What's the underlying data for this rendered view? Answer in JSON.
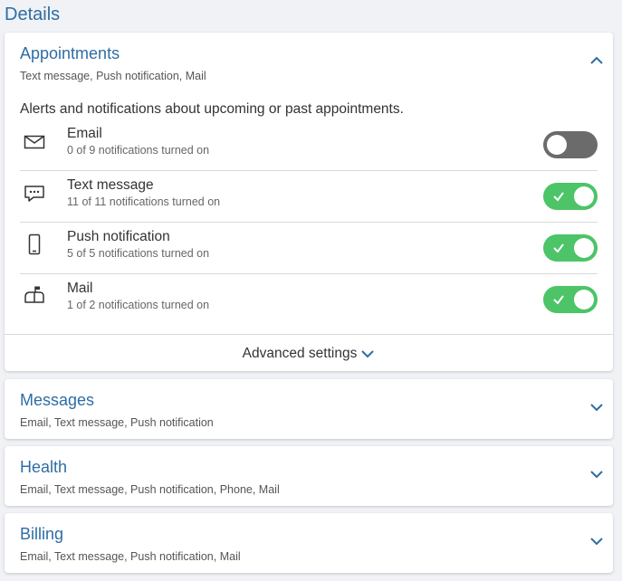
{
  "page": {
    "title": "Details"
  },
  "appointments": {
    "title": "Appointments",
    "subtitle": "Text message, Push notification, Mail",
    "description": "Alerts and notifications about upcoming or past appointments.",
    "channels": [
      {
        "name": "Email",
        "count": "0 of 9 notifications turned on",
        "enabled": false,
        "icon": "envelope-icon"
      },
      {
        "name": "Text message",
        "count": "11 of 11 notifications turned on",
        "enabled": true,
        "icon": "chat-bubble-icon"
      },
      {
        "name": "Push notification",
        "count": "5 of 5 notifications turned on",
        "enabled": true,
        "icon": "phone-icon"
      },
      {
        "name": "Mail",
        "count": "1 of 2 notifications turned on",
        "enabled": true,
        "icon": "mailbox-icon"
      }
    ],
    "advanced_label": "Advanced settings"
  },
  "messages": {
    "title": "Messages",
    "subtitle": "Email, Text message, Push notification"
  },
  "health": {
    "title": "Health",
    "subtitle": "Email, Text message, Push notification, Phone, Mail"
  },
  "billing": {
    "title": "Billing",
    "subtitle": "Email, Text message, Push notification, Mail"
  },
  "colors": {
    "accent": "#2e6da4",
    "toggle_on": "#4cc467",
    "toggle_off": "#6b6b6b"
  }
}
